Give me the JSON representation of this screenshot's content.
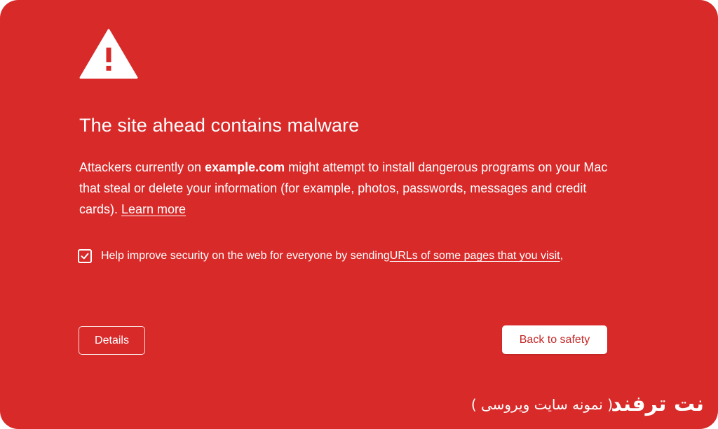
{
  "page": {
    "background_color": "#d92a2a",
    "accent_text_color": "#c62828"
  },
  "icon": {
    "name": "warning-triangle-icon"
  },
  "title": "The site ahead contains malware",
  "body": {
    "part1": "Attackers currently on ",
    "domain": "example.com",
    "part2": " might attempt to install dangerous programs on your Mac that steal or delete your information (for example, photos, passwords, messages and credit cards). ",
    "learn_more": "Learn more"
  },
  "checkbox": {
    "checked": true,
    "label": "Help improve security on the web for everyone by sending ",
    "link": "URLs of some pages that you visit",
    "trailing": ","
  },
  "buttons": {
    "details": "Details",
    "back_to_safety": "Back to safety"
  },
  "watermark": {
    "logo": "نت ترفند",
    "caption": "( نمونه سایت ویروسی )"
  }
}
